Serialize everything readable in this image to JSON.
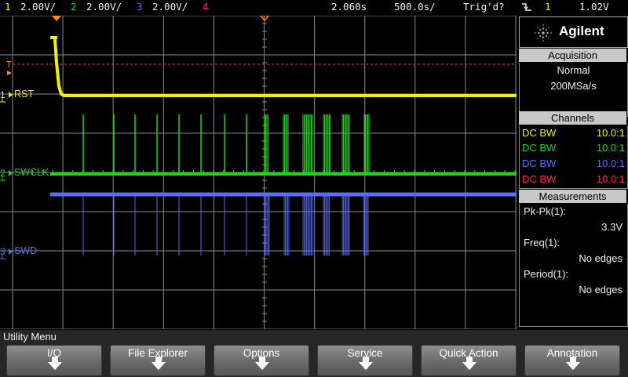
{
  "top_bar": {
    "ch1_num": "1",
    "ch1_scale": "2.00V/",
    "ch2_num": "2",
    "ch2_scale": "2.00V/",
    "ch3_num": "3",
    "ch3_scale": "2.00V/",
    "ch4_num": "4",
    "delay": "2.060s",
    "timebase": "500.0s/",
    "trigger_status": "Trig'd?",
    "trigger_slope_icon": "falling-edge-icon",
    "trigger_source": "1",
    "trigger_level": "1.02V"
  },
  "colors": {
    "ch1": "#f0f000",
    "ch2": "#22d022",
    "ch3": "#5a6cf0",
    "ch4": "#ff2060",
    "grid": "#8a8a8a",
    "trigger_marker": "#ff8c1a"
  },
  "channel_labels": {
    "ch1": "RST",
    "ch2": "SWCLK",
    "ch3": "SWD",
    "ch1_num": "1",
    "ch2_num": "2",
    "ch3_num": "3",
    "trigger_marker": "T"
  },
  "sidebar": {
    "brand": "Agilent",
    "acquisition": {
      "header": "Acquisition",
      "mode": "Normal",
      "rate": "200MSa/s"
    },
    "channels": {
      "header": "Channels",
      "rows": [
        {
          "coupling": "DC BW",
          "probe": "10.0:1"
        },
        {
          "coupling": "DC BW",
          "probe": "10.0:1"
        },
        {
          "coupling": "DC BW",
          "probe": "10.0:1"
        },
        {
          "coupling": "DC BW",
          "probe": "10.0:1"
        }
      ]
    },
    "measurements": {
      "header": "Measurements",
      "items": [
        {
          "label": "Pk-Pk(1):",
          "value": "3.3V"
        },
        {
          "label": "Freq(1):",
          "value": "No edges"
        },
        {
          "label": "Period(1):",
          "value": "No edges"
        }
      ]
    }
  },
  "menu": {
    "title": "Utility Menu",
    "softkeys": [
      "I/O",
      "File Explorer",
      "Options",
      "Service",
      "Quick Action",
      "Annotation"
    ]
  }
}
